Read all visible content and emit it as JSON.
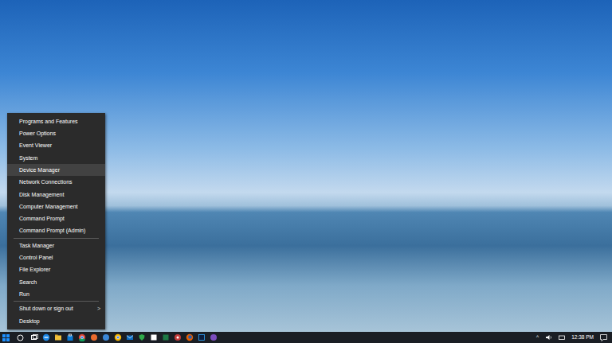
{
  "menu": {
    "groups": [
      {
        "items": [
          {
            "label": "Programs and Features",
            "selected": false
          },
          {
            "label": "Power Options",
            "selected": false
          },
          {
            "label": "Event Viewer",
            "selected": false
          },
          {
            "label": "System",
            "selected": false
          },
          {
            "label": "Device Manager",
            "selected": true
          },
          {
            "label": "Network Connections",
            "selected": false
          },
          {
            "label": "Disk Management",
            "selected": false
          },
          {
            "label": "Computer Management",
            "selected": false
          },
          {
            "label": "Command Prompt",
            "selected": false
          },
          {
            "label": "Command Prompt (Admin)",
            "selected": false
          }
        ]
      },
      {
        "items": [
          {
            "label": "Task Manager",
            "selected": false
          },
          {
            "label": "Control Panel",
            "selected": false
          },
          {
            "label": "File Explorer",
            "selected": false
          },
          {
            "label": "Search",
            "selected": false
          },
          {
            "label": "Run",
            "selected": false
          }
        ]
      },
      {
        "items": [
          {
            "label": "Shut down or sign out",
            "selected": false,
            "submenu_arrow": ">"
          },
          {
            "label": "Desktop",
            "selected": false
          }
        ]
      }
    ]
  },
  "taskbar": {
    "tray_chevron": "^",
    "clock": "12:38 PM"
  }
}
